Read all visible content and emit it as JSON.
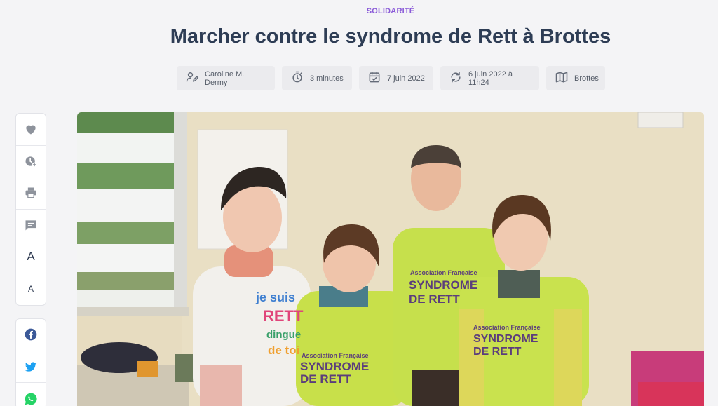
{
  "article": {
    "category": "SOLIDARITÉ",
    "category_color": "#8a5ad8",
    "title": "Marcher contre le syndrome de Rett à Brottes"
  },
  "meta": {
    "author": "Caroline M. Dermy",
    "reading_time": "3 minutes",
    "published": "7 juin 2022",
    "updated": "6 juin 2022 à 11h24",
    "location": "Brottes"
  },
  "sidebar": {
    "actions": [
      {
        "icon": "heart-icon"
      },
      {
        "icon": "bookmark-add-icon"
      },
      {
        "icon": "printer-icon"
      },
      {
        "icon": "comment-icon"
      },
      {
        "label": "A"
      },
      {
        "label": "A"
      }
    ],
    "share": [
      {
        "icon": "facebook-icon",
        "color": "#3b5998"
      },
      {
        "icon": "twitter-icon",
        "color": "#1da1f2"
      },
      {
        "icon": "whatsapp-icon",
        "color": "#25d366"
      }
    ]
  },
  "photo": {
    "shirt_text_lines": [
      "Association Française",
      "SYNDROME",
      "DE RETT"
    ],
    "left_shirt_text": [
      "je suis",
      "RETT",
      "dingue",
      "de toi"
    ]
  }
}
